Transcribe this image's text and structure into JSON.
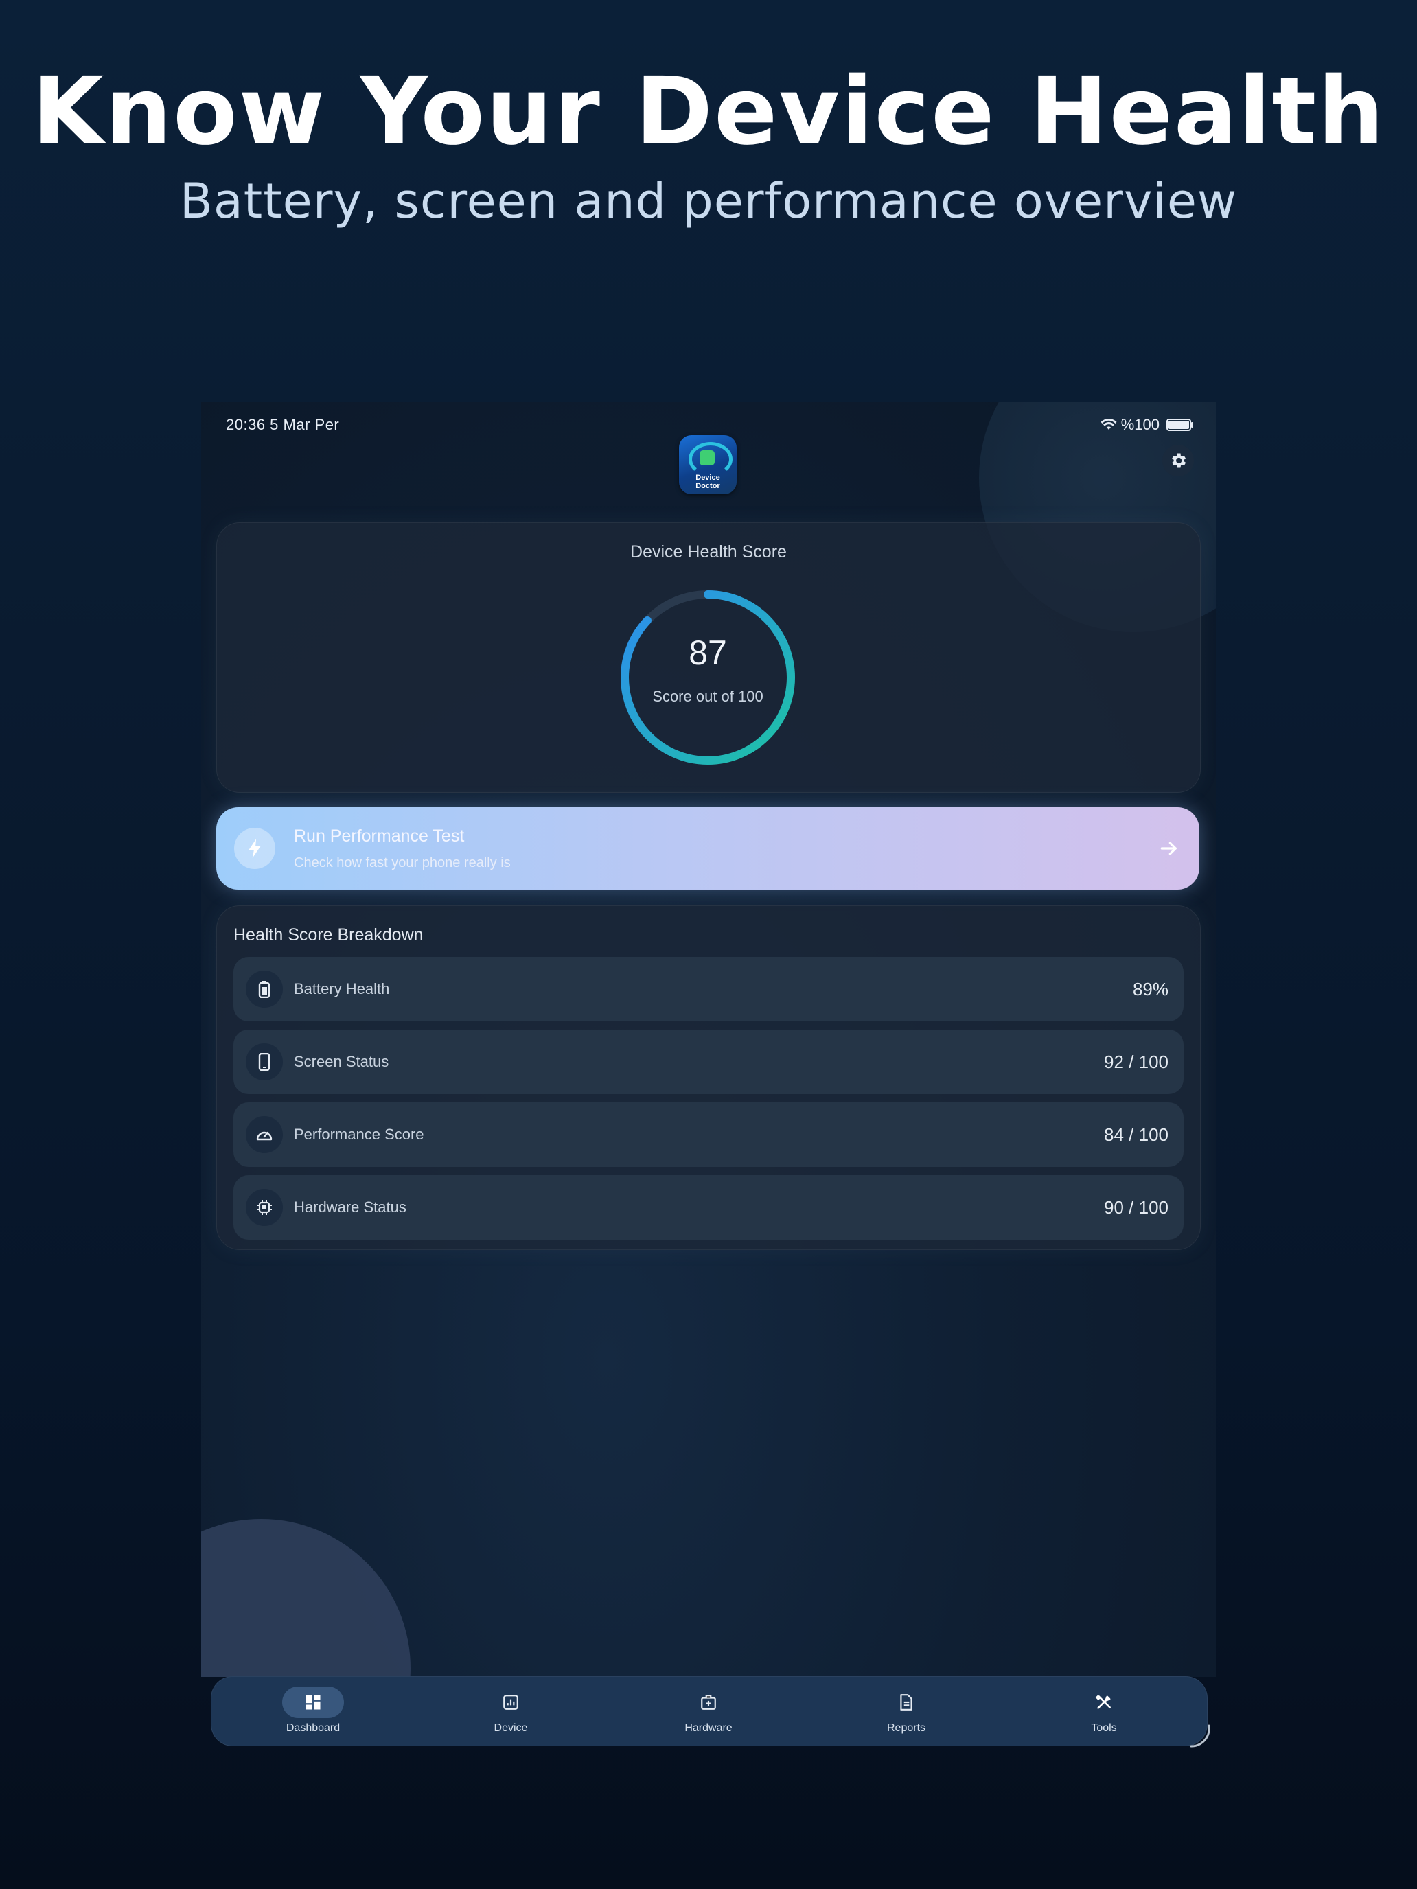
{
  "promo": {
    "headline": "Know Your Device Health",
    "subheadline": "Battery, screen and performance overview"
  },
  "status_bar": {
    "time_date": "20:36  5 Mar Per",
    "battery_text": "%100",
    "battery_level": 1.0
  },
  "app": {
    "logo_text_line1": "Device",
    "logo_text_line2": "Doctor",
    "settings_icon": "gear-icon"
  },
  "health_score": {
    "title": "Device Health Score",
    "value": "87",
    "caption": "Score out of 100",
    "fraction": 0.87,
    "gradient_start": "#1ec3a4",
    "gradient_end": "#2d8cf0"
  },
  "performance_test": {
    "title": "Run Performance Test",
    "subtitle": "Check how fast your phone really is",
    "icon": "lightning-icon",
    "arrow_icon": "arrow-right-icon"
  },
  "breakdown": {
    "title": "Health Score Breakdown",
    "items": [
      {
        "label": "Battery Health",
        "value": "89%",
        "icon": "battery-icon"
      },
      {
        "label": "Screen Status",
        "value": "92 / 100",
        "icon": "phone-icon"
      },
      {
        "label": "Performance Score",
        "value": "84 / 100",
        "icon": "speedometer-icon"
      },
      {
        "label": "Hardware Status",
        "value": "90 / 100",
        "icon": "chip-icon"
      }
    ]
  },
  "tabs": [
    {
      "label": "Dashboard",
      "icon": "dashboard-icon",
      "active": true
    },
    {
      "label": "Device",
      "icon": "device-icon",
      "active": false
    },
    {
      "label": "Hardware",
      "icon": "hardware-icon",
      "active": false
    },
    {
      "label": "Reports",
      "icon": "reports-icon",
      "active": false
    },
    {
      "label": "Tools",
      "icon": "tools-icon",
      "active": false
    }
  ],
  "colors": {
    "accent_teal": "#1ec3a4",
    "accent_blue": "#2d8cf0",
    "tabbar_bg": "#1d3655"
  }
}
